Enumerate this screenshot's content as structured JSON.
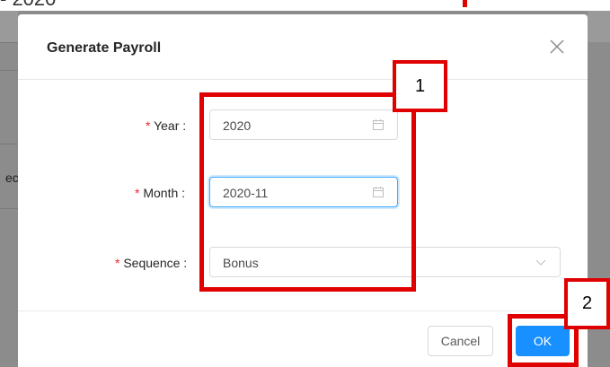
{
  "background": {
    "title_fragment": "- 2020",
    "side_text": "ec"
  },
  "modal": {
    "title": "Generate Payroll",
    "close_glyph": "X",
    "fields": {
      "year": {
        "required_mark": "*",
        "label": "Year :",
        "value": "2020",
        "icon": "calendar-icon"
      },
      "month": {
        "required_mark": "*",
        "label": "Month :",
        "value": "2020-11",
        "icon": "calendar-icon"
      },
      "sequence": {
        "required_mark": "*",
        "label": "Sequence :",
        "value": "Bonus",
        "icon": "chevron-down-icon"
      }
    },
    "buttons": {
      "cancel": "Cancel",
      "ok": "OK"
    }
  },
  "annotations": {
    "step1": "1",
    "step2": "2"
  },
  "colors": {
    "primary": "#1890ff",
    "annotation": "#e00000",
    "required": "#f5222d"
  }
}
